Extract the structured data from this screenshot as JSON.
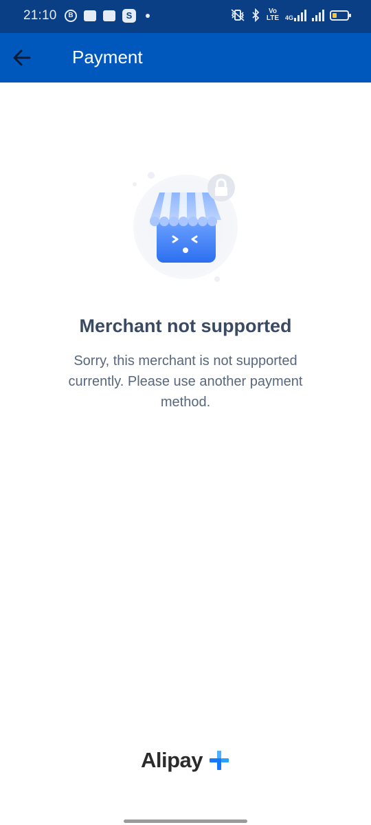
{
  "status_bar": {
    "time": "21:10",
    "left_icons": [
      "b-circle-icon",
      "app-icon",
      "uniqlo-icon",
      "s-app-icon",
      "dot-icon"
    ],
    "right_icons": [
      "vibrate-icon",
      "bluetooth-icon",
      "volte-icon",
      "signal-4g-icon",
      "signal-icon",
      "battery-icon"
    ],
    "volte_label": "Vo LTE",
    "network_label": "4G"
  },
  "app_bar": {
    "title": "Payment",
    "background": "#0058bc"
  },
  "error": {
    "title": "Merchant not supported",
    "message": "Sorry, this merchant is not supported currently. Please use another payment method.",
    "illustration": "store-lock-icon"
  },
  "brand": {
    "name": "Alipay",
    "mark": "plus-logo-icon",
    "accent": "#1677ff"
  }
}
